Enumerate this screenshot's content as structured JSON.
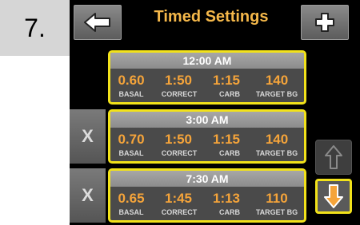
{
  "step": "7.",
  "header": {
    "title": "Timed Settings"
  },
  "segments": [
    {
      "time": "12:00 AM",
      "basal": "0.60",
      "correct": "1:50",
      "carb": "1:15",
      "target_bg": "140"
    },
    {
      "time": "3:00 AM",
      "basal": "0.70",
      "correct": "1:50",
      "carb": "1:15",
      "target_bg": "140"
    },
    {
      "time": "7:30 AM",
      "basal": "0.65",
      "correct": "1:45",
      "carb": "1:13",
      "target_bg": "110"
    }
  ],
  "labels": {
    "basal": "BASAL",
    "correct": "CORRECT",
    "carb": "CARB",
    "target_bg": "TARGET BG"
  },
  "delete_label": "X",
  "icons": {
    "back": "back-arrow-icon",
    "add": "plus-icon",
    "up": "up-arrow-icon",
    "down": "down-arrow-icon"
  },
  "colors": {
    "accent": "#f5b84a",
    "value": "#f5a43a",
    "highlight": "#f2e21a"
  }
}
